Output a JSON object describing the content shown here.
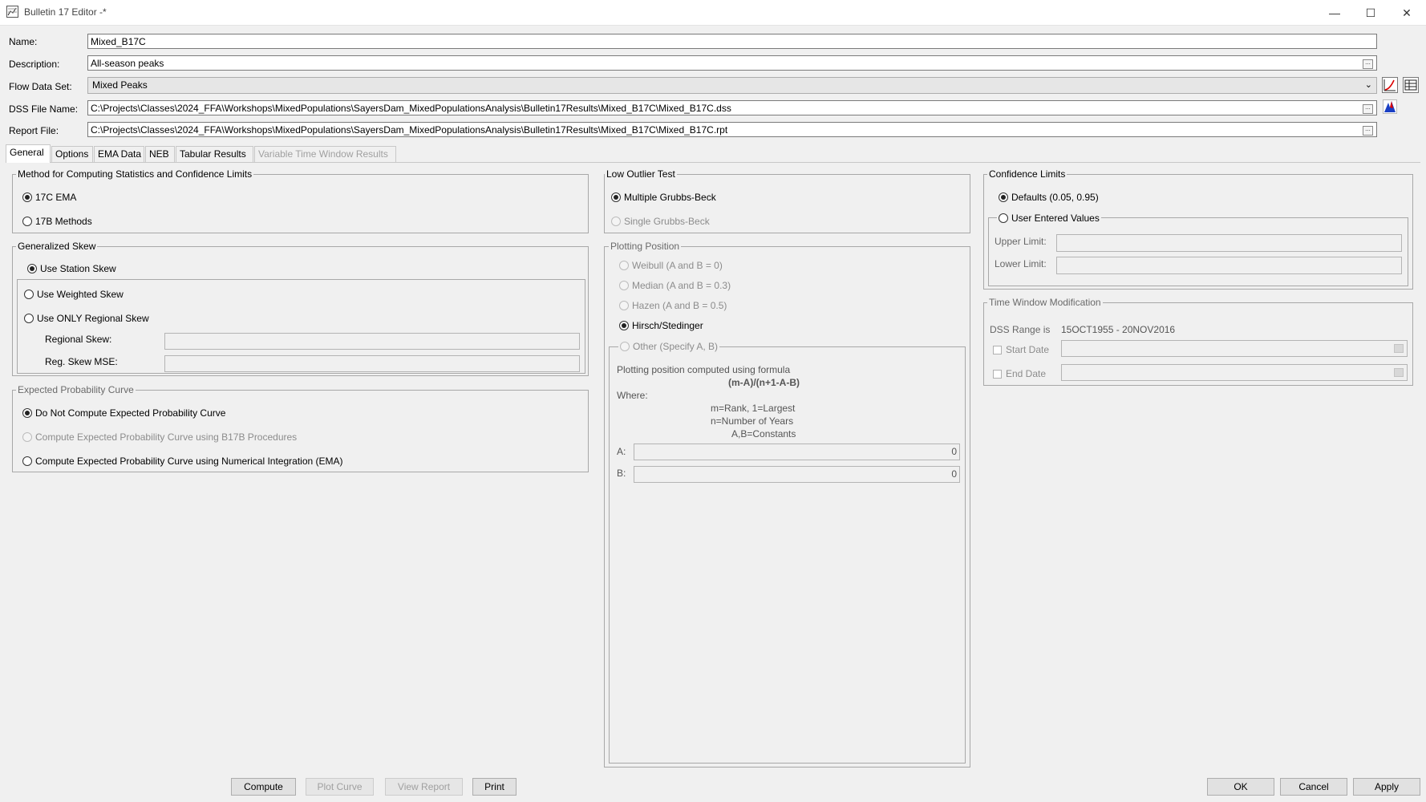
{
  "window": {
    "title": "Bulletin 17 Editor -*",
    "minimize": "—",
    "maximize": "☐",
    "close": "✕"
  },
  "header": {
    "name_label": "Name:",
    "name_value": "Mixed_B17C",
    "description_label": "Description:",
    "description_value": "All-season peaks",
    "flow_label": "Flow Data Set:",
    "flow_value": "Mixed Peaks",
    "dss_label": "DSS File Name:",
    "dss_value": "C:\\Projects\\Classes\\2024_FFA\\Workshops\\MixedPopulations\\SayersDam_MixedPopulationsAnalysis\\Bulletin17Results\\Mixed_B17C\\Mixed_B17C.dss",
    "report_label": "Report File:",
    "report_value": "C:\\Projects\\Classes\\2024_FFA\\Workshops\\MixedPopulations\\SayersDam_MixedPopulationsAnalysis\\Bulletin17Results\\Mixed_B17C\\Mixed_B17C.rpt",
    "browse_label": "..."
  },
  "tabs": [
    {
      "label": "General"
    },
    {
      "label": "Options"
    },
    {
      "label": "EMA Data"
    },
    {
      "label": "NEB"
    },
    {
      "label": "Tabular Results"
    },
    {
      "label": "Variable Time Window Results"
    }
  ],
  "method": {
    "title": "Method for Computing Statistics and Confidence Limits",
    "opt1": "17C EMA",
    "opt2": "17B Methods"
  },
  "gen_skew": {
    "title": "Generalized Skew",
    "station": "Use Station Skew",
    "weighted": "Use Weighted Skew",
    "regional_only": "Use ONLY Regional Skew",
    "regional_skew_label": "Regional Skew:",
    "reg_mse_label": "Reg. Skew MSE:"
  },
  "expected": {
    "title": "Expected Probability Curve",
    "opt1": "Do Not Compute Expected Probability Curve",
    "opt2": "Compute Expected Probability Curve using B17B Procedures",
    "opt3": "Compute Expected Probability Curve using Numerical Integration (EMA)"
  },
  "low_outlier": {
    "title": "Low Outlier Test",
    "opt1": "Multiple Grubbs-Beck",
    "opt2": "Single Grubbs-Beck"
  },
  "plotting": {
    "title": "Plotting Position",
    "weibull": "Weibull (A and B = 0)",
    "median": "Median (A and B = 0.3)",
    "hazen": "Hazen (A and B = 0.5)",
    "hirsch": "Hirsch/Stedinger",
    "other": "Other (Specify A, B)",
    "formula_intro": "Plotting position computed using formula",
    "formula": "(m-A)/(n+1-A-B)",
    "where": "Where:",
    "def_m": "m=Rank, 1=Largest",
    "def_n": "n=Number of Years",
    "def_ab": "A,B=Constants",
    "a_label": "A:",
    "a_value": "0",
    "b_label": "B:",
    "b_value": "0"
  },
  "confidence": {
    "title": "Confidence Limits",
    "defaults": "Defaults (0.05, 0.95)",
    "user": "User Entered Values",
    "upper_label": "Upper Limit:",
    "lower_label": "Lower Limit:"
  },
  "time_window": {
    "title": "Time Window Modification",
    "dss_range_label": "DSS Range is",
    "dss_range_value": "15OCT1955 - 20NOV2016",
    "start_label": "Start Date",
    "end_label": "End Date"
  },
  "buttons": {
    "compute": "Compute",
    "plot": "Plot Curve",
    "view_report": "View Report",
    "print": "Print",
    "ok": "OK",
    "cancel": "Cancel",
    "apply": "Apply"
  }
}
